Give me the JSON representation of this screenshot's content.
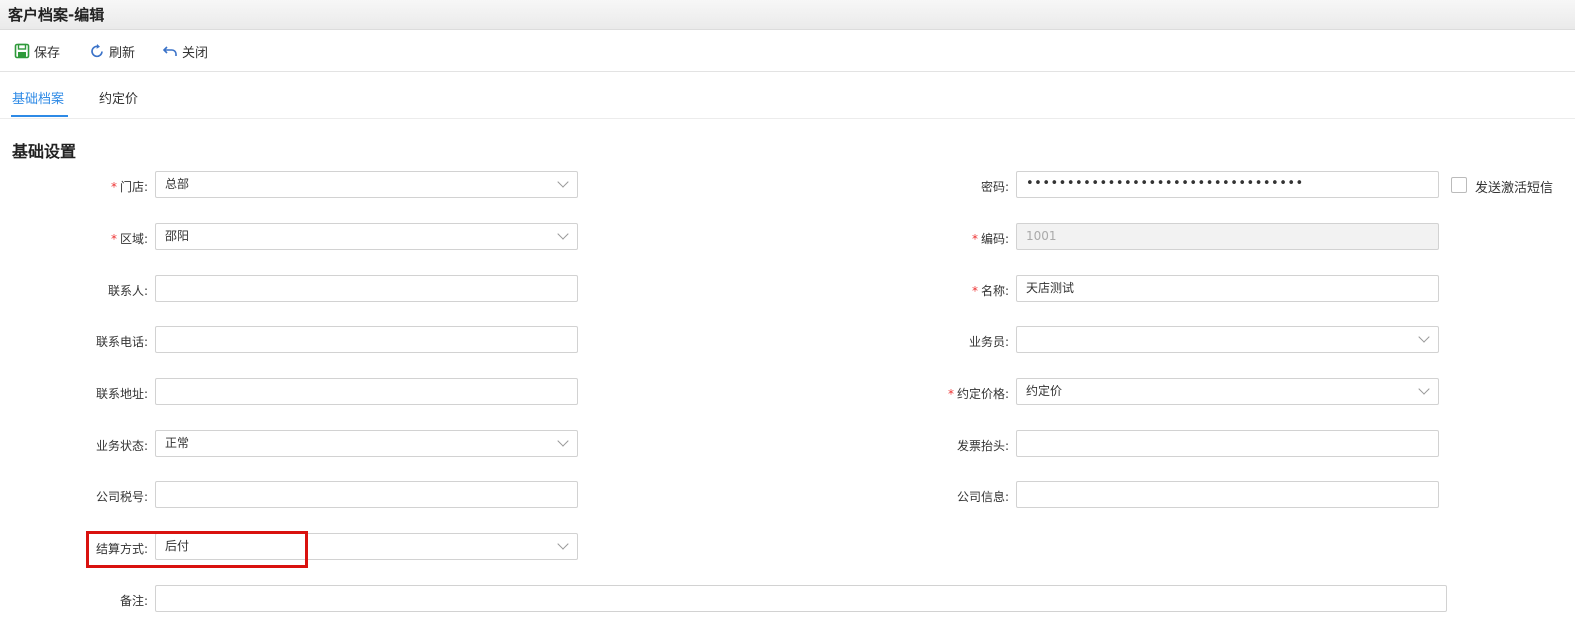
{
  "window": {
    "title": "客户档案-编辑"
  },
  "toolbar": {
    "save": "保存",
    "refresh": "刷新",
    "close": "关闭"
  },
  "tabs": [
    {
      "label": "基础档案",
      "active": true
    },
    {
      "label": "约定价",
      "active": false
    }
  ],
  "section": {
    "title": "基础设置"
  },
  "required_mark": "*",
  "left": {
    "store": {
      "label": "门店:",
      "value": "总部"
    },
    "region": {
      "label": "区域:",
      "value": "邵阳"
    },
    "contact": {
      "label": "联系人:",
      "value": ""
    },
    "phone": {
      "label": "联系电话:",
      "value": ""
    },
    "address": {
      "label": "联系地址:",
      "value": ""
    },
    "status": {
      "label": "业务状态:",
      "value": "正常"
    },
    "tax_no": {
      "label": "公司税号:",
      "value": ""
    },
    "settlement": {
      "label": "结算方式:",
      "value": "后付"
    },
    "remark": {
      "label": "备注:",
      "value": ""
    }
  },
  "right": {
    "password": {
      "label": "密码:",
      "value": "••••••••••••••••••••••••••••••••••"
    },
    "sms": {
      "label": "发送激活短信",
      "checked": false
    },
    "code": {
      "label": "编码:",
      "value": "1001"
    },
    "name": {
      "label": "名称:",
      "value": "天店测试"
    },
    "salesman": {
      "label": "业务员:",
      "value": ""
    },
    "price": {
      "label": "约定价格:",
      "value": "约定价"
    },
    "invoice": {
      "label": "发票抬头:",
      "value": ""
    },
    "company_info": {
      "label": "公司信息:",
      "value": ""
    }
  },
  "colors": {
    "accent": "#2e8ae6",
    "required": "#ee3333",
    "highlight": "#d9120f",
    "save_icon": "#2e9a3a"
  }
}
